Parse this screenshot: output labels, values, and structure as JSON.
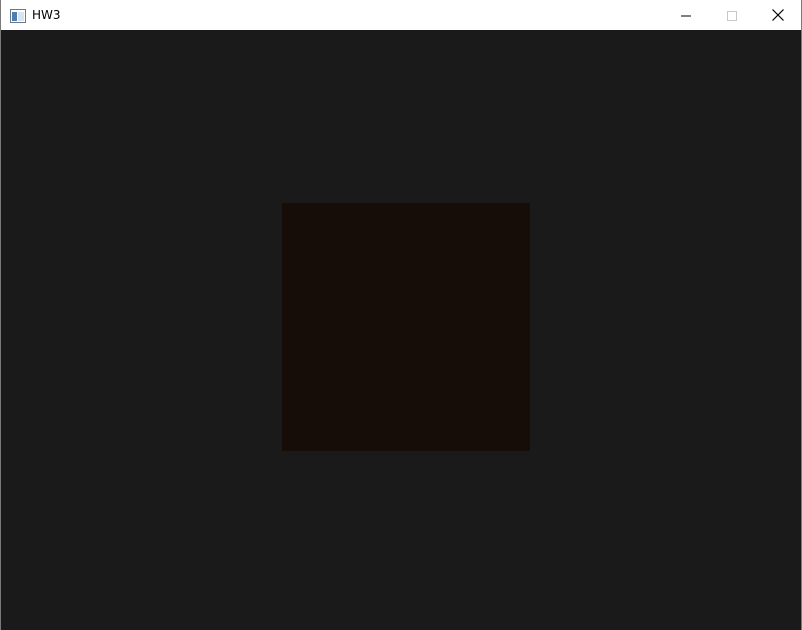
{
  "window": {
    "title": "HW3",
    "icon": "window-app-icon",
    "controls": {
      "minimize": "minimize-icon",
      "maximize": "maximize-icon",
      "close": "close-icon"
    }
  },
  "canvas": {
    "background_color": "#1a1a1a",
    "square_color": "#160d08"
  }
}
